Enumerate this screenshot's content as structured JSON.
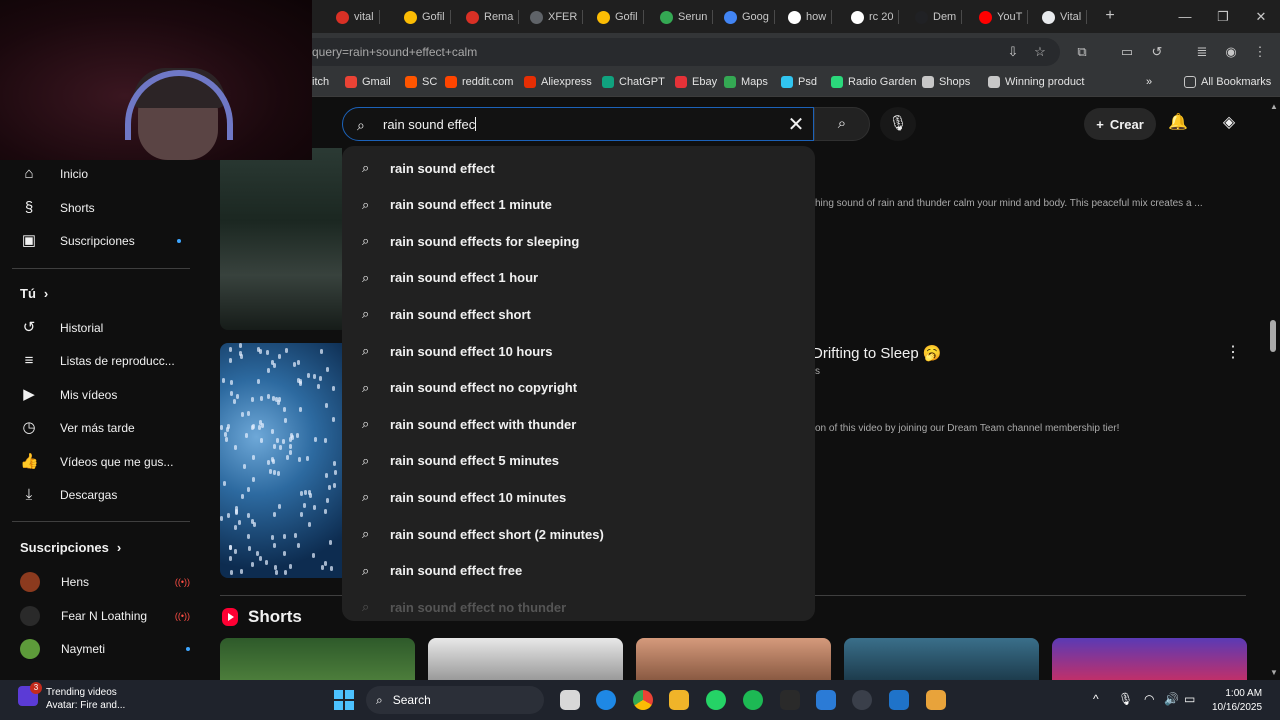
{
  "browser": {
    "tabs": [
      {
        "label": "vital",
        "color": "#d93025"
      },
      {
        "label": "Gofil",
        "color": "#fbbc04"
      },
      {
        "label": "Rema",
        "color": "#d93025"
      },
      {
        "label": "XFER",
        "color": "#5f6368"
      },
      {
        "label": "Gofil",
        "color": "#fbbc04"
      },
      {
        "label": "Serun",
        "color": "#34a853"
      },
      {
        "label": "Goog",
        "color": "#4285f4"
      },
      {
        "label": "how",
        "color": "#ffffff"
      },
      {
        "label": "rc 20",
        "color": "#ffffff"
      },
      {
        "label": "Dem",
        "color": "#202124"
      },
      {
        "label": "YouT",
        "color": "#ff0000"
      },
      {
        "label": "Vital",
        "color": "#e8eaed"
      }
    ],
    "newtab": "+",
    "window_controls": {
      "minimize": "—",
      "restore": "❐",
      "close": "✕"
    },
    "url": "query=rain+sound+effect+calm",
    "bookmarks": [
      {
        "label": "itch",
        "color": "#9146ff"
      },
      {
        "label": "Gmail",
        "color": "#ea4335"
      },
      {
        "label": "SC",
        "color": "#ff5500"
      },
      {
        "label": "reddit.com",
        "color": "#ff4500"
      },
      {
        "label": "Aliexpress",
        "color": "#e62e04"
      },
      {
        "label": "ChatGPT",
        "color": "#10a37f"
      },
      {
        "label": "Ebay",
        "color": "#e53238"
      },
      {
        "label": "Maps",
        "color": "#34a853"
      },
      {
        "label": "Psd",
        "color": "#31c5f0"
      },
      {
        "label": "Radio Garden",
        "color": "#2bd87b"
      },
      {
        "label": "Shops",
        "color": "#c7c7c7"
      },
      {
        "label": "Winning product",
        "color": "#c7c7c7"
      }
    ],
    "bookmarks_more": "»",
    "all_bookmarks": "All Bookmarks"
  },
  "youtube": {
    "search": {
      "query": "rain sound effec",
      "search_glyph": "⌕",
      "clear_glyph": "✕",
      "mic_glyph": "🎙"
    },
    "create_label": "Crear",
    "create_glyph": "+",
    "bell_glyph": "🔔",
    "suggestions": [
      "rain sound effect",
      "rain sound effect 1 minute",
      "rain sound effects for sleeping",
      "rain sound effect 1 hour",
      "rain sound effect short",
      "rain sound effect 10 hours",
      "rain sound effect no copyright",
      "rain sound effect with thunder",
      "rain sound effect 5 minutes",
      "rain sound effect 10 minutes",
      "rain sound effect short (2 minutes)",
      "rain sound effect free",
      "rain sound effect no thunder"
    ],
    "sidebar": {
      "main": [
        {
          "label": "Inicio",
          "icon": "home-icon",
          "glyph": "⌂"
        },
        {
          "label": "Shorts",
          "icon": "shorts-icon",
          "glyph": "§"
        },
        {
          "label": "Suscripciones",
          "icon": "subscriptions-icon",
          "glyph": "▣"
        }
      ],
      "you_header": "Tú",
      "you": [
        {
          "label": "Historial",
          "icon": "history-icon",
          "glyph": "↺"
        },
        {
          "label": "Listas de reproducc...",
          "icon": "playlists-icon",
          "glyph": "≡"
        },
        {
          "label": "Mis vídeos",
          "icon": "my-videos-icon",
          "glyph": "▶"
        },
        {
          "label": "Ver más tarde",
          "icon": "watch-later-icon",
          "glyph": "◷"
        },
        {
          "label": "Vídeos que me gus...",
          "icon": "liked-icon",
          "glyph": "👍"
        },
        {
          "label": "Descargas",
          "icon": "downloads-icon",
          "glyph": "⤓"
        }
      ],
      "subs_header": "Suscripciones",
      "subscriptions": [
        {
          "label": "Hens",
          "color": "#8b3a1e",
          "status": "live",
          "status_glyph": "((•))"
        },
        {
          "label": "Fear N Loathing",
          "color": "#2a2a2a",
          "status": "live",
          "status_glyph": "((•))"
        },
        {
          "label": "Naymeti",
          "color": "#5d9b3a",
          "status": "new"
        }
      ]
    },
    "results": [
      {
        "description": "hing sound of rain and thunder calm your mind and body. This peaceful mix creates a ..."
      },
      {
        "title": "Drifting to Sleep 🥱",
        "meta": "s",
        "description": "on of this video by joining our Dream Team channel membership tier!"
      }
    ],
    "more_glyph": "⋮",
    "shorts_label": "Shorts"
  },
  "taskbar": {
    "trending_title": "Trending videos",
    "trending_sub": "Avatar: Fire and...",
    "trending_badge": "3",
    "search_label": "Search",
    "time": "1:00 AM",
    "date": "10/16/2025",
    "tray_glyph": "^"
  }
}
